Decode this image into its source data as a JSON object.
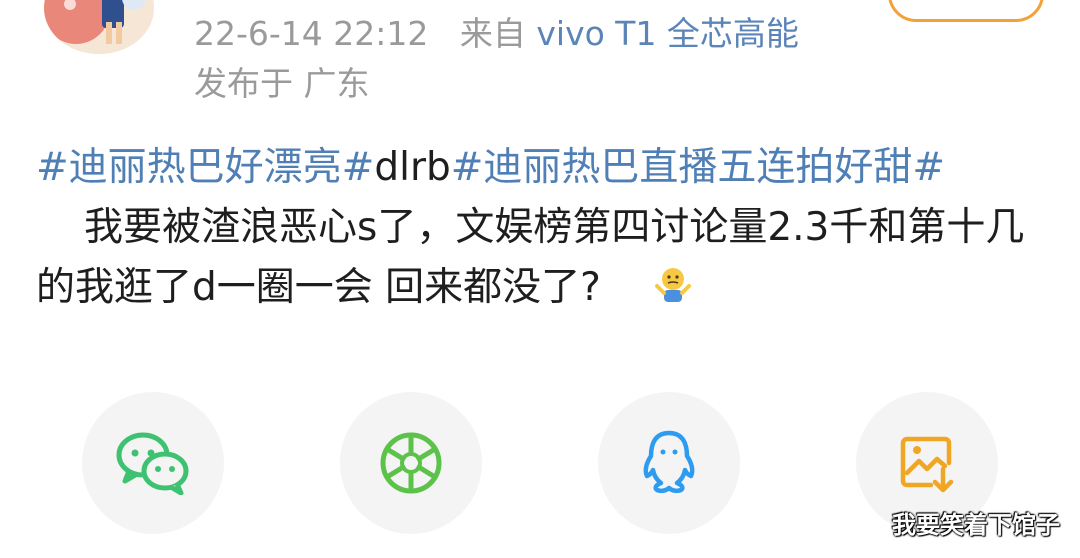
{
  "meta": {
    "timestamp": "22-6-14 22:12",
    "source_prefix": "来自",
    "device": "vivo T1 全芯高能",
    "location": "发布于 广东"
  },
  "post": {
    "tags": [
      {
        "text": "#迪丽热巴好漂亮#",
        "style": "tag"
      },
      {
        "text": "dlrb",
        "style": "plain"
      },
      {
        "text": "#迪丽热巴直播五连拍好甜#",
        "style": "tag"
      }
    ],
    "body": "我要被渣浪恶心s了，文娱榜第四讨论量2.3千和第十几的我逛了d一圈一会 回来都没了?",
    "emoji_icon": "shrug-emoji-icon"
  },
  "share": {
    "items": [
      {
        "icon": "wechat-icon",
        "color": "#3ec271"
      },
      {
        "icon": "moments-icon",
        "color": "#5cc24a"
      },
      {
        "icon": "qq-icon",
        "color": "#2d9cf0"
      },
      {
        "icon": "save-image-icon",
        "color": "#f0a623"
      }
    ]
  },
  "watermark": "我要笑着下馆子",
  "colors": {
    "tag": "#4f7fb4",
    "meta": "#9a9a9a",
    "device": "#5b84b8",
    "follow_border": "#f4a13a"
  }
}
